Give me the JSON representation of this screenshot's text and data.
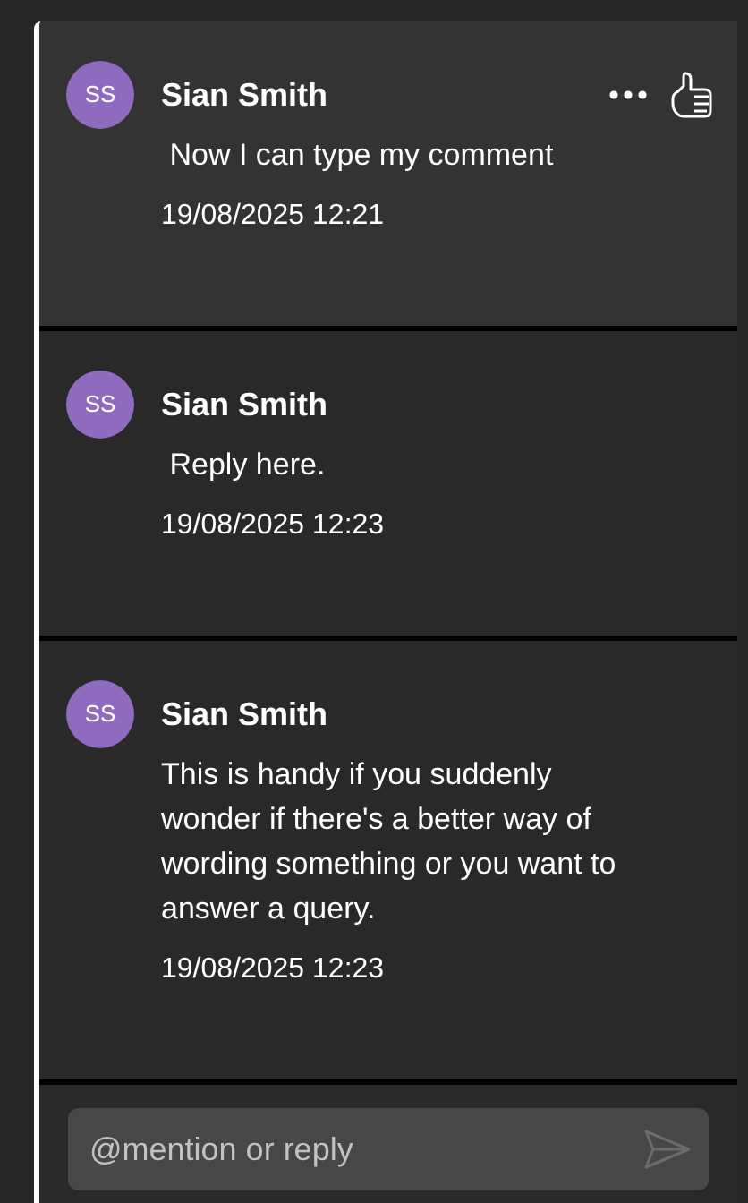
{
  "comments": [
    {
      "initials": "SS",
      "author": "Sian Smith",
      "text": " Now I can type my comment",
      "time": "19/08/2025 12:21",
      "selected": true
    },
    {
      "initials": "SS",
      "author": "Sian Smith",
      "text": " Reply here.",
      "time": "19/08/2025 12:23",
      "selected": false
    },
    {
      "initials": "SS",
      "author": "Sian Smith",
      "text": "This is handy if you suddenly wonder if there's a better way of wording something or you want to answer a query.",
      "time": "19/08/2025 12:23",
      "selected": false
    }
  ],
  "reply": {
    "placeholder": "@mention or reply"
  }
}
